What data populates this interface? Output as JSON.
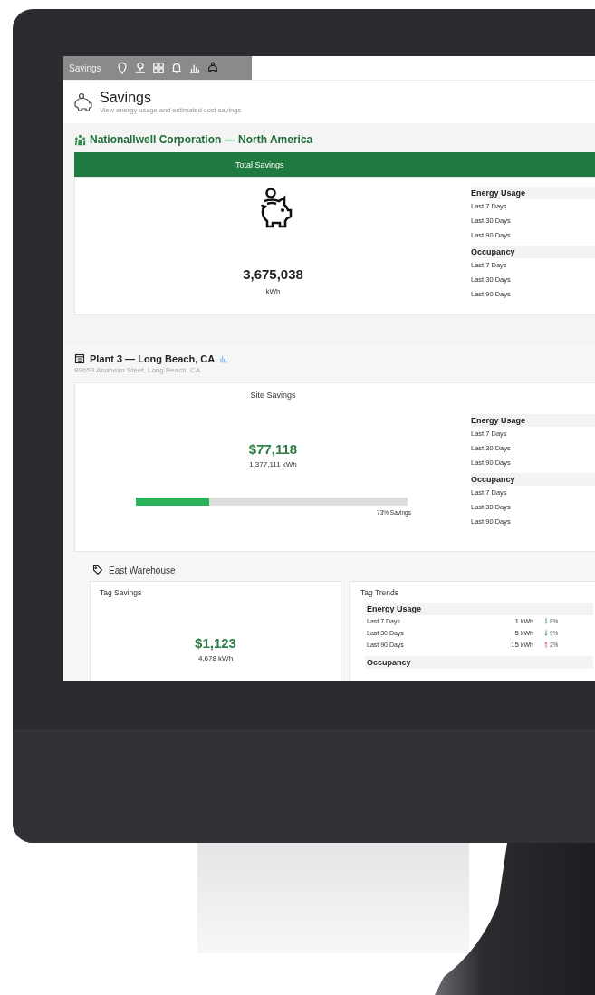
{
  "nav": {
    "label": "Savings",
    "icons": [
      {
        "selected": false
      },
      {
        "selected": false
      },
      {
        "selected": false
      },
      {
        "selected": false
      },
      {
        "selected": false
      },
      {
        "selected": true
      }
    ]
  },
  "header": {
    "title": "Savings",
    "subtitle": "View energy usage and estimated cost savings"
  },
  "company": {
    "name": "Nationallwell Corporation — North America",
    "total_savings": {
      "title": "Total Savings",
      "value": "3,675,038",
      "unit": "kWh",
      "trends": [
        {
          "heading": "Energy Usage",
          "rows": [
            "Last 7 Days",
            "Last 30 Days",
            "Last 90 Days"
          ]
        },
        {
          "heading": "Occupancy",
          "rows": [
            "Last 7 Days",
            "Last 30 Days",
            "Last 90 Days"
          ]
        }
      ]
    }
  },
  "site": {
    "name": "Plant 3 — Long Beach, CA",
    "address": "89653 Anaheim Steet, Long Beach, CA",
    "site_savings": {
      "title": "Site Savings",
      "amount": "$77,118",
      "energy": "1,377,111 kWh",
      "level": 0.27,
      "progress_label": "73% Savings",
      "trends": [
        {
          "heading": "Energy Usage",
          "rows": [
            "Last 7 Days",
            "Last 30 Days",
            "Last 90 Days"
          ]
        },
        {
          "heading": "Occupancy",
          "rows": [
            "Last 7 Days",
            "Last 30 Days",
            "Last 90 Days"
          ]
        }
      ]
    }
  },
  "tag": {
    "name": "East Warehouse",
    "tag_savings": {
      "title": "Tag Savings",
      "amount": "$1,123",
      "energy": "4,678 kWh"
    },
    "tag_trends": {
      "title": "Tag Trends",
      "heading": "Energy Usage",
      "rows": [
        {
          "label": "Last 7 Days",
          "value": "1",
          "unit": "kWh",
          "kind": "down",
          "change": "8%"
        },
        {
          "label": "Last 30 Days",
          "value": "5",
          "unit": "kWh",
          "kind": "down",
          "change": "9%"
        },
        {
          "label": "Last 90 Days",
          "value": "15",
          "unit": "kWh",
          "kind": "up",
          "change": "2%"
        }
      ],
      "next_heading": "Occupancy"
    }
  }
}
